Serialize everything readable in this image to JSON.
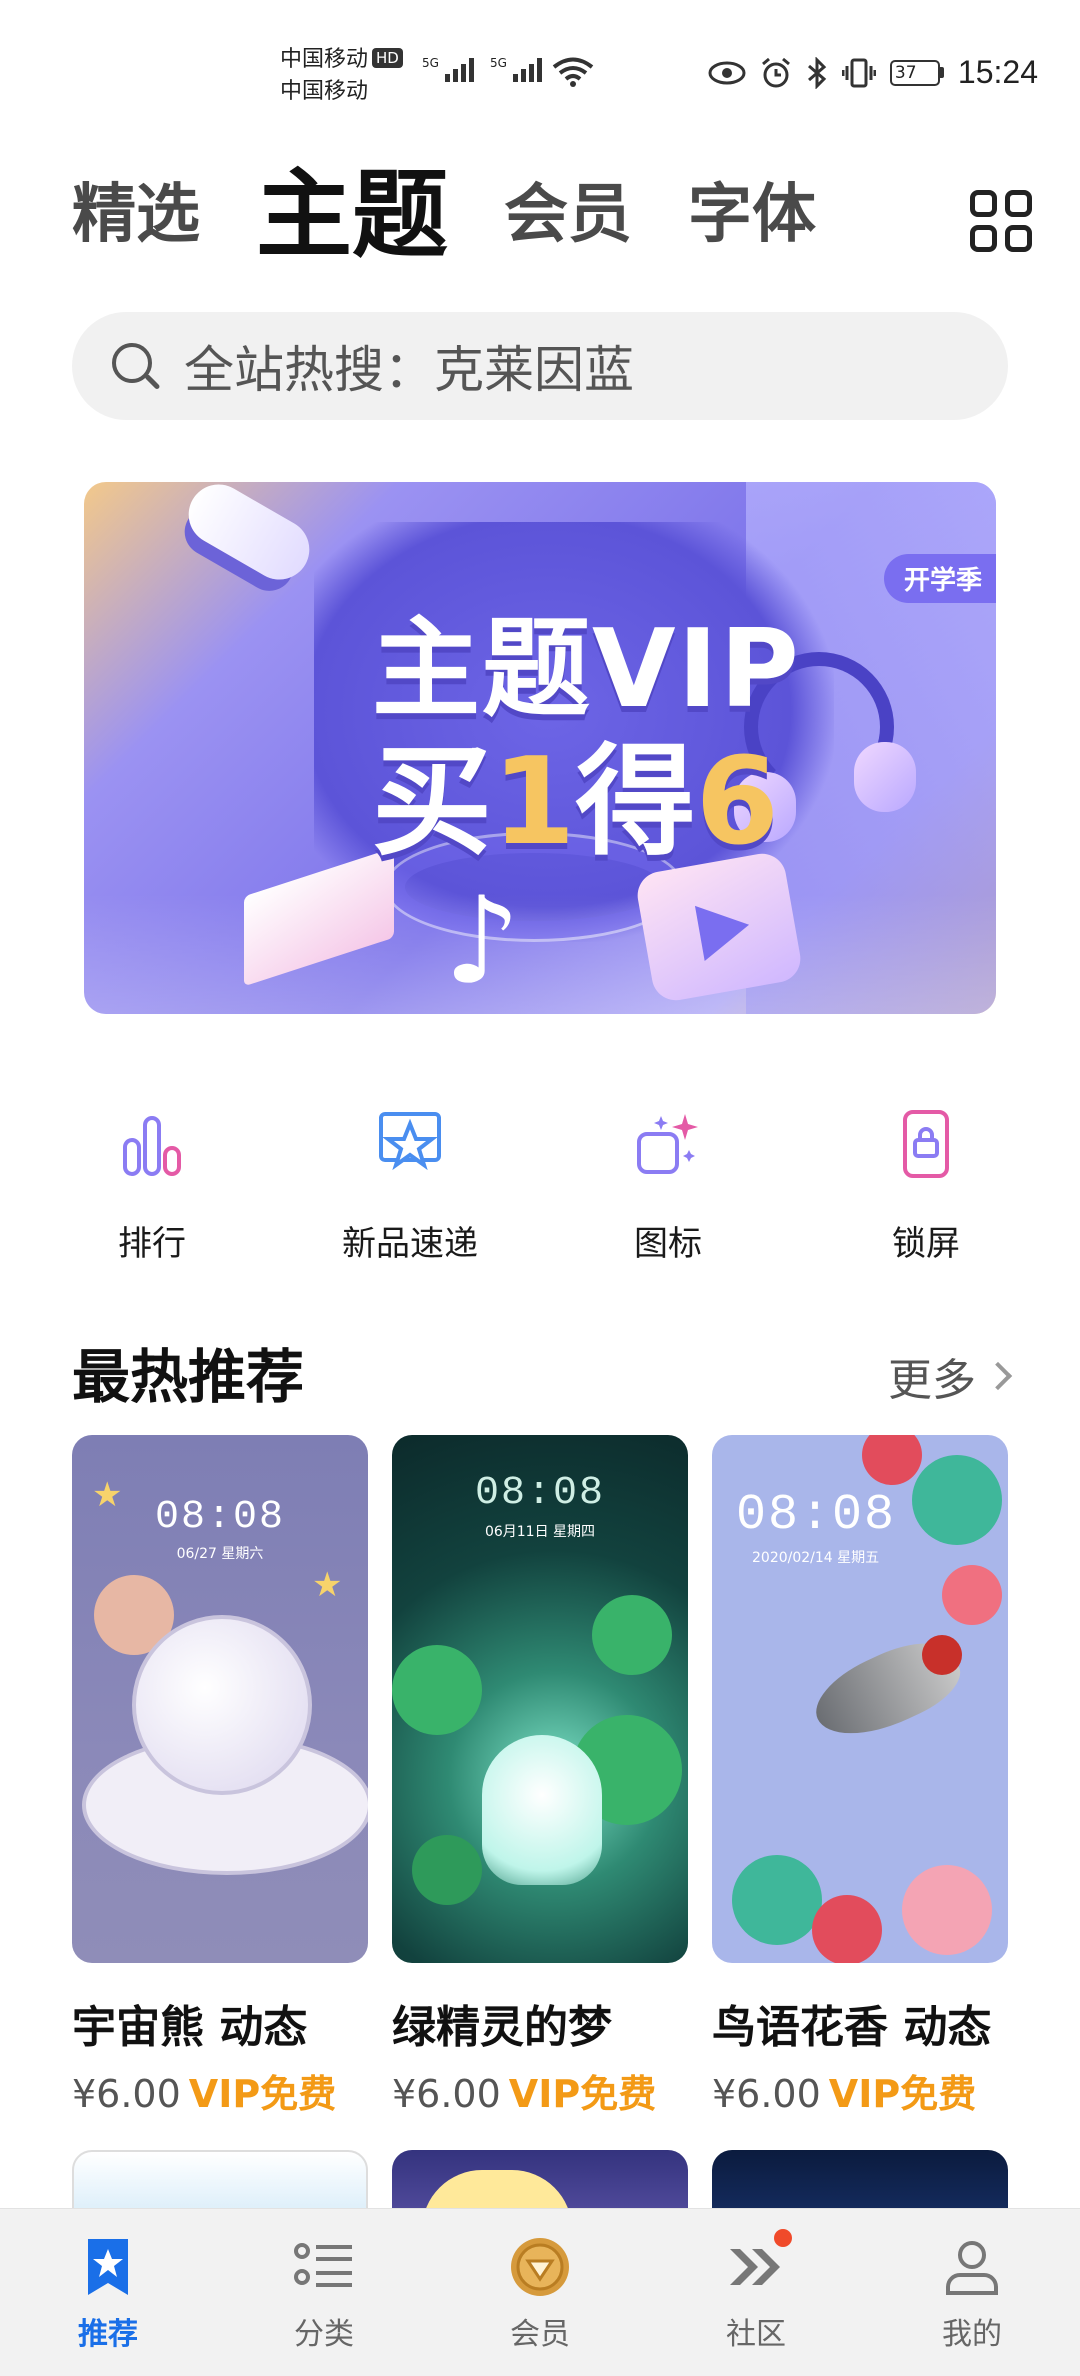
{
  "status_bar": {
    "carrier_1": "中国移动",
    "carrier_1_badge": "HD",
    "carrier_2": "中国移动",
    "network_1": "5G",
    "network_2": "5G",
    "battery": "37",
    "time": "15:24"
  },
  "top_tabs": [
    {
      "label": "精选",
      "active": false
    },
    {
      "label": "主题",
      "active": true
    },
    {
      "label": "会员",
      "active": false
    },
    {
      "label": "字体",
      "active": false
    }
  ],
  "search": {
    "text": "全站热搜：克莱因蓝"
  },
  "banner": {
    "line1": "主题VIP",
    "line2_a": "买",
    "line2_b": "1",
    "line2_c": "得",
    "line2_d": "6",
    "badge": "开学季"
  },
  "quick_entries": [
    {
      "label": "排行",
      "icon": "ranking-icon"
    },
    {
      "label": "新品速递",
      "icon": "new-arrivals-icon"
    },
    {
      "label": "图标",
      "icon": "icons-icon"
    },
    {
      "label": "锁屏",
      "icon": "lockscreen-icon"
    }
  ],
  "section": {
    "title": "最热推荐",
    "more": "更多"
  },
  "cards": [
    {
      "name": "宇宙熊 动态",
      "price": "¥6.00",
      "vip": "VIP免费",
      "time": "08:08",
      "date": "06/27 星期六"
    },
    {
      "name": "绿精灵的梦",
      "price": "¥6.00",
      "vip": "VIP免费",
      "time": "08:08",
      "date": "06月11日 星期四"
    },
    {
      "name": "鸟语花香 动态",
      "price": "¥6.00",
      "vip": "VIP免费",
      "time": "08:08",
      "date": "2020/02/14 星期五"
    }
  ],
  "bottom_nav": [
    {
      "label": "推荐",
      "icon": "star-bookmark-icon",
      "active": true
    },
    {
      "label": "分类",
      "icon": "list-icon",
      "active": false
    },
    {
      "label": "会员",
      "icon": "vip-coin-icon",
      "active": false
    },
    {
      "label": "社区",
      "icon": "community-icon",
      "active": false,
      "badge_dot": true
    },
    {
      "label": "我的",
      "icon": "profile-icon",
      "active": false
    }
  ],
  "colors": {
    "accent": "#1a6fe8",
    "vip": "#f39a16",
    "quick_icon_purple": "#8b7cf3",
    "quick_icon_blue": "#4a8ef0",
    "quick_icon_pink": "#e45aa6",
    "notification_dot": "#f04a2a"
  }
}
